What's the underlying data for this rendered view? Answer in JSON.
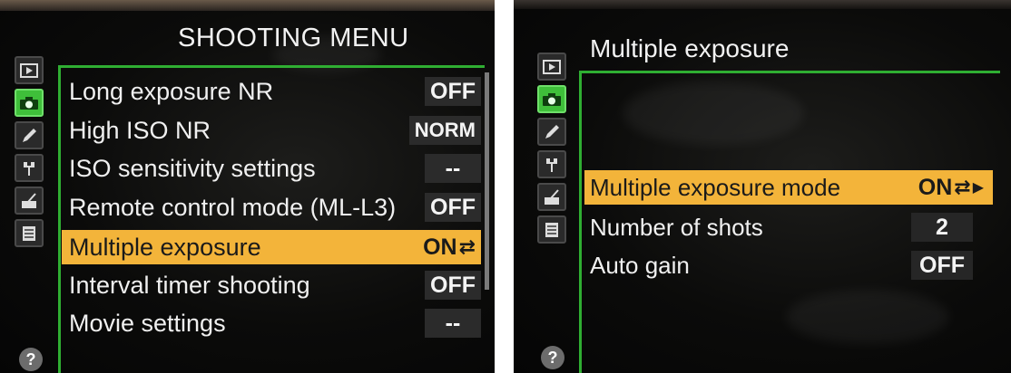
{
  "left": {
    "title": "SHOOTING MENU",
    "icons": [
      {
        "name": "playback-menu-icon"
      },
      {
        "name": "shooting-menu-camera-icon",
        "active": true
      },
      {
        "name": "custom-settings-pencil-icon"
      },
      {
        "name": "setup-menu-wrench-icon"
      },
      {
        "name": "retouch-menu-brush-icon"
      },
      {
        "name": "my-menu-list-icon"
      }
    ],
    "help": "?",
    "items": [
      {
        "label": "Long exposure NR",
        "value": "OFF"
      },
      {
        "label": "High ISO NR",
        "value": "NORM"
      },
      {
        "label": "ISO sensitivity settings",
        "value": "--"
      },
      {
        "label": "Remote control mode (ML-L3)",
        "value": "OFF"
      },
      {
        "label": "Multiple exposure",
        "value": "ON",
        "selected": true
      },
      {
        "label": "Interval timer shooting",
        "value": "OFF"
      },
      {
        "label": "Movie settings",
        "value": "--"
      }
    ]
  },
  "right": {
    "title": "Multiple exposure",
    "help": "?",
    "items": [
      {
        "label": "Multiple exposure mode",
        "value": "ON",
        "selected": true
      },
      {
        "label": "Number of shots",
        "value": "2"
      },
      {
        "label": "Auto gain",
        "value": "OFF"
      }
    ]
  },
  "colors": {
    "highlight": "#f3b43a",
    "border_green": "#2fae32",
    "active_tab": "#3fbf3a"
  }
}
